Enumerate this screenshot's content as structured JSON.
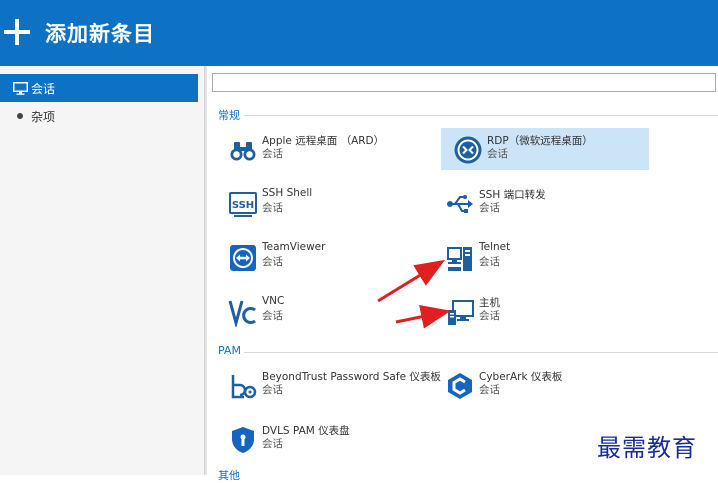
{
  "header": {
    "title": "添加新条目"
  },
  "sidebar": {
    "items": [
      {
        "label": "会话",
        "icon": "monitor-icon",
        "selected": true
      },
      {
        "label": "杂项",
        "icon": "bullet-icon",
        "selected": false
      }
    ]
  },
  "search": {
    "value": ""
  },
  "sections": [
    {
      "title": "常规",
      "entries": [
        {
          "name": "Apple 远程桌面 （ARD）",
          "sub": "会话",
          "icon": "binoculars-icon"
        },
        {
          "name": "RDP（微软远程桌面）",
          "sub": "会话",
          "icon": "rdp-icon",
          "selected": true
        },
        {
          "name": "SSH Shell",
          "sub": "会话",
          "icon": "ssh-icon"
        },
        {
          "name": "SSH 端口转发",
          "sub": "会话",
          "icon": "usb-icon"
        },
        {
          "name": "TeamViewer",
          "sub": "会话",
          "icon": "teamviewer-icon"
        },
        {
          "name": "Telnet",
          "sub": "会话",
          "icon": "telnet-icon"
        },
        {
          "name": "VNC",
          "sub": "会话",
          "icon": "vnc-icon"
        },
        {
          "name": "主机",
          "sub": "会话",
          "icon": "host-icon"
        }
      ]
    },
    {
      "title": "PAM",
      "entries": [
        {
          "name": "BeyondTrust Password Safe 仪表板",
          "sub": "会话",
          "icon": "beyondtrust-icon"
        },
        {
          "name": "CyberArk 仪表板",
          "sub": "会话",
          "icon": "cyberark-icon"
        },
        {
          "name": "DVLS PAM 仪表盘",
          "sub": "会话",
          "icon": "shield-icon"
        }
      ]
    },
    {
      "title": "其他"
    }
  ],
  "watermark": "最需教育",
  "colors": {
    "accent": "#0e72c4",
    "selection": "#cce4f7",
    "annotation_arrow": "#e02020"
  }
}
